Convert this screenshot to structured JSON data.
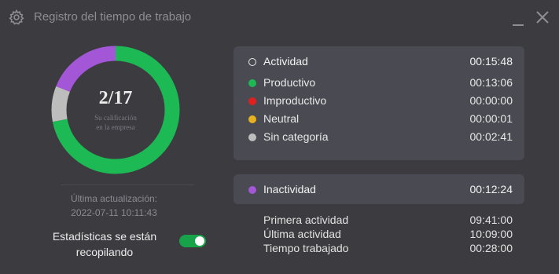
{
  "window": {
    "title": "Registro del tiempo de trabajo",
    "icons": {
      "settings": "gear-icon",
      "minimize": "minimize-icon",
      "close": "close-icon"
    }
  },
  "score": {
    "value": "2/17",
    "subtitle_line1": "Su calificación",
    "subtitle_line2": "en la empresa"
  },
  "donut": {
    "segments": [
      {
        "name": "Productivo",
        "fraction": 0.72,
        "color": "#1db954"
      },
      {
        "name": "Sin categoría",
        "fraction": 0.09,
        "color": "#bdbdbd"
      },
      {
        "name": "Inactividad",
        "fraction": 0.19,
        "color": "#a356d6"
      }
    ]
  },
  "update": {
    "label": "Última actualización:",
    "time": "2022-07-11 10:11:43"
  },
  "stats": {
    "line1": "Estadísticas se están",
    "line2": "recopilando",
    "toggle_on": true,
    "toggle_color": "#17a34a"
  },
  "activity": {
    "header": {
      "label": "Actividad",
      "value": "00:15:48"
    },
    "items": [
      {
        "label": "Productivo",
        "value": "00:13:06",
        "color": "#1db954"
      },
      {
        "label": "Improductivo",
        "value": "00:00:00",
        "color": "#e02020"
      },
      {
        "label": "Neutral",
        "value": "00:00:01",
        "color": "#e6b020"
      },
      {
        "label": "Sin categoría",
        "value": "00:02:41",
        "color": "#bdbdbd"
      }
    ]
  },
  "inactivity": {
    "label": "Inactividad",
    "value": "00:12:24",
    "color": "#a356d6"
  },
  "summary": [
    {
      "label": "Primera actividad",
      "value": "09:41:00"
    },
    {
      "label": "Última actividad",
      "value": "10:09:00"
    },
    {
      "label": "Tiempo trabajado",
      "value": "00:28:00"
    }
  ]
}
